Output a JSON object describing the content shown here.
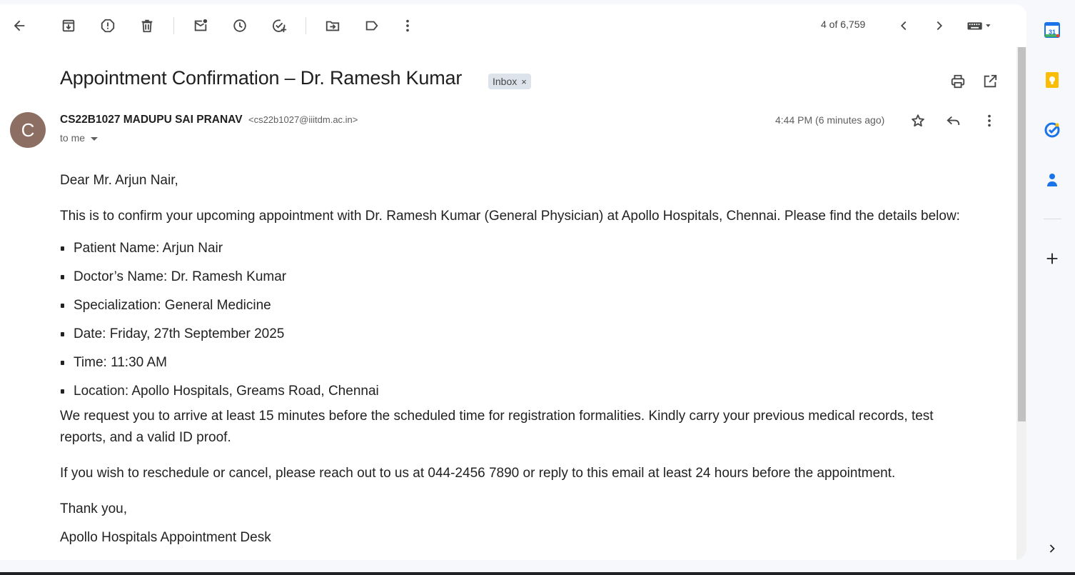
{
  "toolbar": {
    "counter": "4 of 6,759",
    "icons": [
      "back-icon",
      "archive-icon",
      "report-spam-icon",
      "delete-icon",
      "mark-unread-icon",
      "snooze-icon",
      "add-to-tasks-icon",
      "move-to-icon",
      "label-icon",
      "more-vert-icon",
      "prev-icon",
      "next-icon",
      "keyboard-icon"
    ]
  },
  "email": {
    "subject": "Appointment Confirmation – Dr. Ramesh Kumar",
    "label_chip": "Inbox",
    "chip_close": "×",
    "avatar_letter": "C",
    "sender_name": "CS22B1027 MADUPU SAI PRANAV",
    "sender_email": "<cs22b1027@iiitdm.ac.in>",
    "recipient": "to me",
    "timestamp": "4:44 PM (6 minutes ago)",
    "body": {
      "greeting": "Dear Mr. Arjun Nair,",
      "intro": "This is to confirm your upcoming appointment with Dr. Ramesh Kumar (General Physician) at Apollo Hospitals, Chennai. Please find the details below:",
      "details": [
        "Patient Name: Arjun Nair",
        "Doctor’s Name: Dr. Ramesh Kumar",
        "Specialization: General Medicine",
        "Date: Friday, 27th September 2025",
        "Time: 11:30 AM",
        "Location: Apollo Hospitals, Greams Road, Chennai"
      ],
      "request": "We request you to arrive at least 15 minutes before the scheduled time for registration formalities. Kindly carry your previous medical records, test reports, and a valid ID proof.",
      "reschedule": "If you wish to reschedule or cancel, please reach out to us at 044-2456 7890 or reply to this email at least 24 hours before the appointment.",
      "closing": "Thank you,",
      "signature": "Apollo Hospitals Appointment Desk"
    }
  },
  "side_panel": {
    "calendar_day": "31",
    "icons": [
      "calendar-icon",
      "keep-icon",
      "tasks-icon",
      "contacts-icon",
      "add-addon-icon",
      "expand-panel-icon"
    ]
  },
  "colors": {
    "background": "#f6f8fc",
    "avatar": "#8d6e63",
    "chip": "#dde3ea",
    "calendar_blue": "#1a73e8",
    "keep_yellow": "#fbbc04",
    "tasks_blue": "#1a73e8",
    "contacts_blue": "#1a73e8"
  }
}
